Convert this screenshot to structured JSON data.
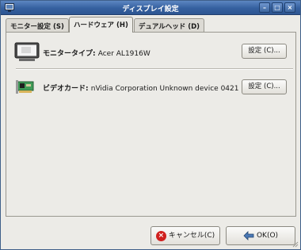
{
  "window": {
    "title": "ディスプレイ設定",
    "min_glyph": "–",
    "max_glyph": "□",
    "close_glyph": "×"
  },
  "tabs": [
    {
      "label": "モニター設定 (S)",
      "active": false
    },
    {
      "label": "ハードウェア (H)",
      "active": true
    },
    {
      "label": "デュアルヘッド (D)",
      "active": false
    }
  ],
  "hardware": {
    "monitor": {
      "label": "モニタータイプ: ",
      "value": "Acer AL1916W",
      "button": "設定 (C)..."
    },
    "video": {
      "label": "ビデオカード: ",
      "value": "nVidia Corporation Unknown device 0421",
      "button": "設定 (C)..."
    }
  },
  "footer": {
    "cancel": "キャンセル(C)",
    "ok": "OK(O)"
  },
  "icons": {
    "app": "display-icon",
    "monitor": "monitor-icon",
    "video": "video-card-icon",
    "cancel": "cancel-icon",
    "ok": "ok-icon"
  },
  "colors": {
    "titlebar": "#35609f",
    "window_bg": "#ecebe7",
    "cancel_red": "#d0201e"
  }
}
